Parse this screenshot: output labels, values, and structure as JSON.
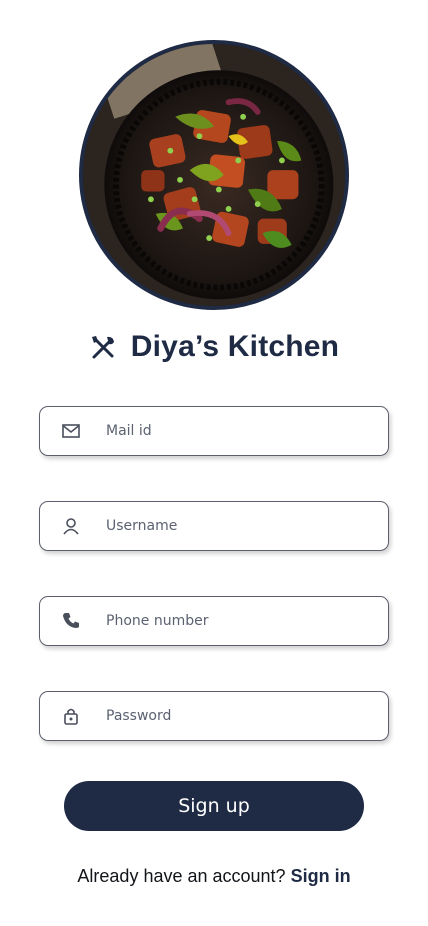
{
  "app": {
    "name": "Diya’s Kitchen",
    "brand_icon": "fork-and-knife-icon",
    "hero_image": "food-plate-image"
  },
  "form": {
    "fields": [
      {
        "name": "email",
        "placeholder": "Mail id",
        "icon": "mail-icon",
        "value": ""
      },
      {
        "name": "username",
        "placeholder": "Username",
        "icon": "user-icon",
        "value": ""
      },
      {
        "name": "phone",
        "placeholder": "Phone number",
        "icon": "phone-icon",
        "value": ""
      },
      {
        "name": "password",
        "placeholder": "Password",
        "icon": "lock-icon",
        "value": ""
      }
    ],
    "submit_label": "Sign up"
  },
  "footer": {
    "prompt": "Already have an account?",
    "link_label": "Sign in"
  },
  "colors": {
    "primary": "#1f2a44",
    "field_border": "#5b5f6b",
    "placeholder": "#5b6170",
    "background": "#ffffff"
  }
}
